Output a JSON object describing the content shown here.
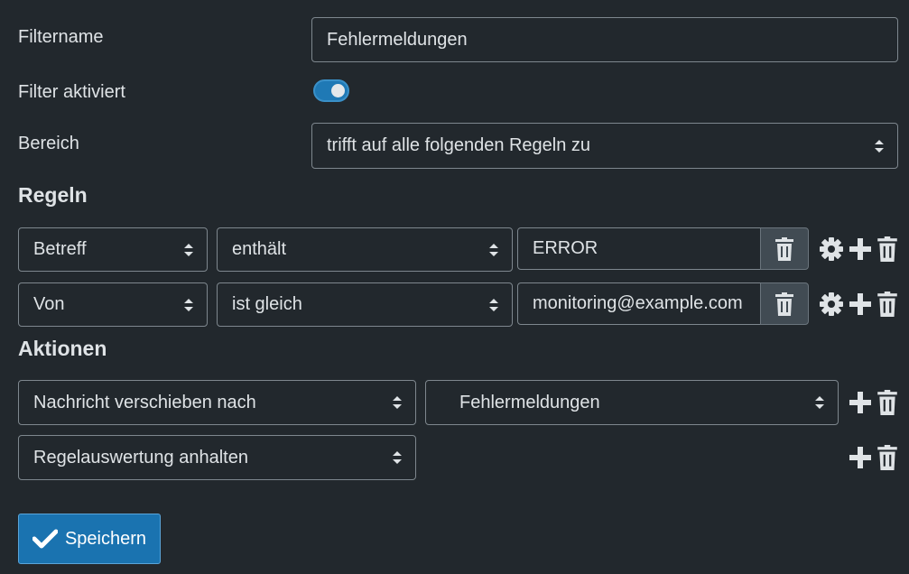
{
  "form": {
    "filtername_label": "Filtername",
    "filtername_value": "Fehlermeldungen",
    "enabled_label": "Filter aktiviert",
    "enabled": true,
    "scope_label": "Bereich",
    "scope_value": "trifft auf alle folgenden Regeln zu"
  },
  "rules": {
    "heading": "Regeln",
    "items": [
      {
        "header": "Betreff",
        "op": "enthält",
        "value": "ERROR"
      },
      {
        "header": "Von",
        "op": "ist gleich",
        "value": "monitoring@example.com"
      }
    ]
  },
  "actions": {
    "heading": "Aktionen",
    "items": [
      {
        "type": "Nachricht verschieben nach",
        "target": "Fehlermeldungen"
      },
      {
        "type": "Regelauswertung anhalten"
      }
    ]
  },
  "save_label": "Speichern",
  "icons": [
    "sort-icon",
    "trash-icon",
    "gear-icon",
    "plus-icon",
    "check-icon"
  ],
  "colors": {
    "background": "#22282d",
    "accent": "#1a73b0",
    "text": "#dfe3e6"
  }
}
